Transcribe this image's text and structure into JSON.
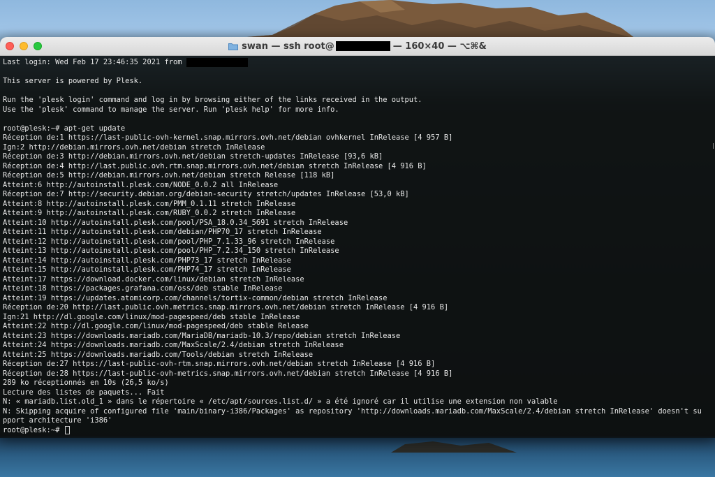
{
  "window": {
    "title_prefix": "swan — ssh root@",
    "title_suffix": "— 160×40 — ⌥⌘&",
    "colors": {
      "close": "#fe5f57",
      "minimize": "#febc2e",
      "maximize": "#28c840",
      "terminal_text": "#e8e8e8"
    }
  },
  "terminal": {
    "login_line": "Last login: Wed Feb 17 23:46:35 2021 from ",
    "lines": [
      "",
      "This server is powered by Plesk.",
      "",
      "Run the 'plesk login' command and log in by browsing either of the links received in the output.",
      "Use the 'plesk' command to manage the server. Run 'plesk help' for more info.",
      "",
      "root@plesk:~# apt-get update",
      "Réception de:1 https://last-public-ovh-kernel.snap.mirrors.ovh.net/debian ovhkernel InRelease [4 957 B]",
      "Ign:2 http://debian.mirrors.ovh.net/debian stretch InRelease",
      "Réception de:3 http://debian.mirrors.ovh.net/debian stretch-updates InRelease [93,6 kB]",
      "Réception de:4 http://last.public.ovh.rtm.snap.mirrors.ovh.net/debian stretch InRelease [4 916 B]",
      "Réception de:5 http://debian.mirrors.ovh.net/debian stretch Release [118 kB]",
      "Atteint:6 http://autoinstall.plesk.com/NODE_0.0.2 all InRelease",
      "Réception de:7 http://security.debian.org/debian-security stretch/updates InRelease [53,0 kB]",
      "Atteint:8 http://autoinstall.plesk.com/PMM_0.1.11 stretch InRelease",
      "Atteint:9 http://autoinstall.plesk.com/RUBY_0.0.2 stretch InRelease",
      "Atteint:10 http://autoinstall.plesk.com/pool/PSA_18.0.34_5691 stretch InRelease",
      "Atteint:11 http://autoinstall.plesk.com/debian/PHP70_17 stretch InRelease",
      "Atteint:12 http://autoinstall.plesk.com/pool/PHP_7.1.33_96 stretch InRelease",
      "Atteint:13 http://autoinstall.plesk.com/pool/PHP_7.2.34_150 stretch InRelease",
      "Atteint:14 http://autoinstall.plesk.com/PHP73_17 stretch InRelease",
      "Atteint:15 http://autoinstall.plesk.com/PHP74_17 stretch InRelease",
      "Atteint:17 https://download.docker.com/linux/debian stretch InRelease",
      "Atteint:18 https://packages.grafana.com/oss/deb stable InRelease",
      "Atteint:19 https://updates.atomicorp.com/channels/tortix-common/debian stretch InRelease",
      "Réception de:20 http://last.public.ovh.metrics.snap.mirrors.ovh.net/debian stretch InRelease [4 916 B]",
      "Ign:21 http://dl.google.com/linux/mod-pagespeed/deb stable InRelease",
      "Atteint:22 http://dl.google.com/linux/mod-pagespeed/deb stable Release",
      "Atteint:23 https://downloads.mariadb.com/MariaDB/mariadb-10.3/repo/debian stretch InRelease",
      "Atteint:24 https://downloads.mariadb.com/MaxScale/2.4/debian stretch InRelease",
      "Atteint:25 https://downloads.mariadb.com/Tools/debian stretch InRelease",
      "Réception de:27 https://last-public-ovh-rtm.snap.mirrors.ovh.net/debian stretch InRelease [4 916 B]",
      "Réception de:28 https://last-public-ovh-metrics.snap.mirrors.ovh.net/debian stretch InRelease [4 916 B]",
      "289 ko réceptionnés en 10s (26,5 ko/s)",
      "Lecture des listes de paquets... Fait",
      "N: « mariadb.list.old_1 » dans le répertoire « /etc/apt/sources.list.d/ » a été ignoré car il utilise une extension non valable",
      "N: Skipping acquire of configured file 'main/binary-i386/Packages' as repository 'http://downloads.mariadb.com/MaxScale/2.4/debian stretch InRelease' doesn't su",
      "pport architecture 'i386'"
    ],
    "prompt": "root@plesk:~# "
  }
}
